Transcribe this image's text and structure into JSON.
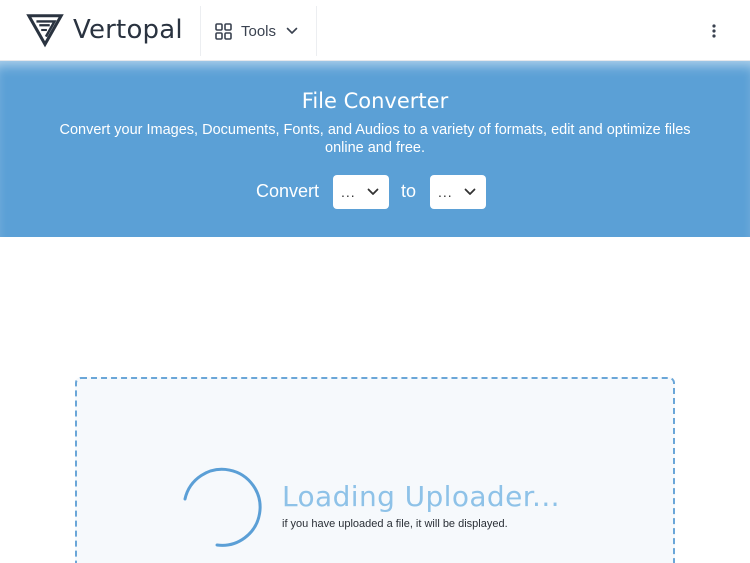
{
  "header": {
    "brand_name": "Vertopal",
    "tools_label": "Tools"
  },
  "hero": {
    "title": "File Converter",
    "subtitle": "Convert your Images, Documents, Fonts, and Audios to a variety of formats, edit and optimize files online and free.",
    "convert_label": "Convert",
    "to_label": "to",
    "from_value": "...",
    "to_value": "..."
  },
  "uploader": {
    "title": "Loading Uploader...",
    "note": "if you have uploaded a file, it will be displayed."
  },
  "colors": {
    "hero_bg": "#5ba0d6",
    "accent": "#5b9fd6",
    "loading_text": "#8ec2e8"
  }
}
